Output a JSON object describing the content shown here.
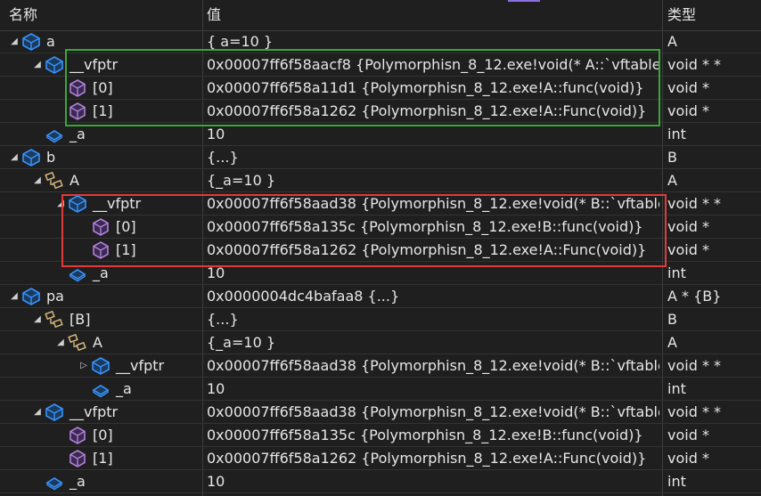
{
  "header": {
    "name": "名称",
    "value": "值",
    "type": "类型"
  },
  "rows": [
    {
      "name": "a",
      "value": "{ a=10 }",
      "type": "A",
      "expander": "expanded",
      "icon": "object-icon"
    },
    {
      "name": "__vfptr",
      "value": "0x00007ff6f58aacf8 {Polymorphisn_8_12.exe!void(* A::`vftable'[...",
      "type": "void * *",
      "expander": "expanded",
      "icon": "object-icon"
    },
    {
      "name": "[0]",
      "value": "0x00007ff6f58a11d1 {Polymorphisn_8_12.exe!A::func(void)}",
      "type": "void *",
      "expander": "none",
      "icon": "method-icon"
    },
    {
      "name": "[1]",
      "value": "0x00007ff6f58a1262 {Polymorphisn_8_12.exe!A::Func(void)}",
      "type": "void *",
      "expander": "none",
      "icon": "method-icon"
    },
    {
      "name": "_a",
      "value": "10",
      "type": "int",
      "expander": "none",
      "icon": "field-icon"
    },
    {
      "name": "b",
      "value": "{...}",
      "type": "B",
      "expander": "expanded",
      "icon": "object-icon"
    },
    {
      "name": "A",
      "value": "{_a=10 }",
      "type": "A",
      "expander": "expanded",
      "icon": "base-class-icon"
    },
    {
      "name": "__vfptr",
      "value": "0x00007ff6f58aad38 {Polymorphisn_8_12.exe!void(* B::`vftable'...",
      "type": "void * *",
      "expander": "expanded",
      "icon": "object-icon"
    },
    {
      "name": "[0]",
      "value": "0x00007ff6f58a135c {Polymorphisn_8_12.exe!B::func(void)}",
      "type": "void *",
      "expander": "none",
      "icon": "method-icon"
    },
    {
      "name": "[1]",
      "value": "0x00007ff6f58a1262 {Polymorphisn_8_12.exe!A::Func(void)}",
      "type": "void *",
      "expander": "none",
      "icon": "method-icon"
    },
    {
      "name": "_a",
      "value": "10",
      "type": "int",
      "expander": "none",
      "icon": "field-icon"
    },
    {
      "name": "pa",
      "value": "0x0000004dc4bafaa8 {...}",
      "type": "A * {B}",
      "expander": "expanded",
      "icon": "object-icon"
    },
    {
      "name": "[B]",
      "value": "{...}",
      "type": "B",
      "expander": "expanded",
      "icon": "base-class-icon"
    },
    {
      "name": "A",
      "value": "{_a=10 }",
      "type": "A",
      "expander": "expanded",
      "icon": "base-class-icon"
    },
    {
      "name": "__vfptr",
      "value": "0x00007ff6f58aad38 {Polymorphisn_8_12.exe!void(* B::`vftable'...",
      "type": "void * *",
      "expander": "collapsed",
      "icon": "object-icon"
    },
    {
      "name": "_a",
      "value": "10",
      "type": "int",
      "expander": "none",
      "icon": "field-icon"
    },
    {
      "name": "__vfptr",
      "value": "0x00007ff6f58aad38 {Polymorphisn_8_12.exe!void(* B::`vftable'...",
      "type": "void * *",
      "expander": "expanded",
      "icon": "object-icon"
    },
    {
      "name": "[0]",
      "value": "0x00007ff6f58a135c {Polymorphisn_8_12.exe!B::func(void)}",
      "type": "void *",
      "expander": "none",
      "icon": "method-icon"
    },
    {
      "name": "[1]",
      "value": "0x00007ff6f58a1262 {Polymorphisn_8_12.exe!A::Func(void)}",
      "type": "void *",
      "expander": "none",
      "icon": "method-icon"
    },
    {
      "name": "_a",
      "value": "10",
      "type": "int",
      "expander": "none",
      "icon": "field-icon"
    }
  ],
  "colors": {
    "background": "#1f1f1f",
    "grid": "#333333",
    "object_icon": "#3794ff",
    "method_icon": "#b180d7",
    "base_class_icon": "#d7ba7d",
    "highlight_green": "#3aa63a",
    "highlight_red": "#e23a3a"
  }
}
